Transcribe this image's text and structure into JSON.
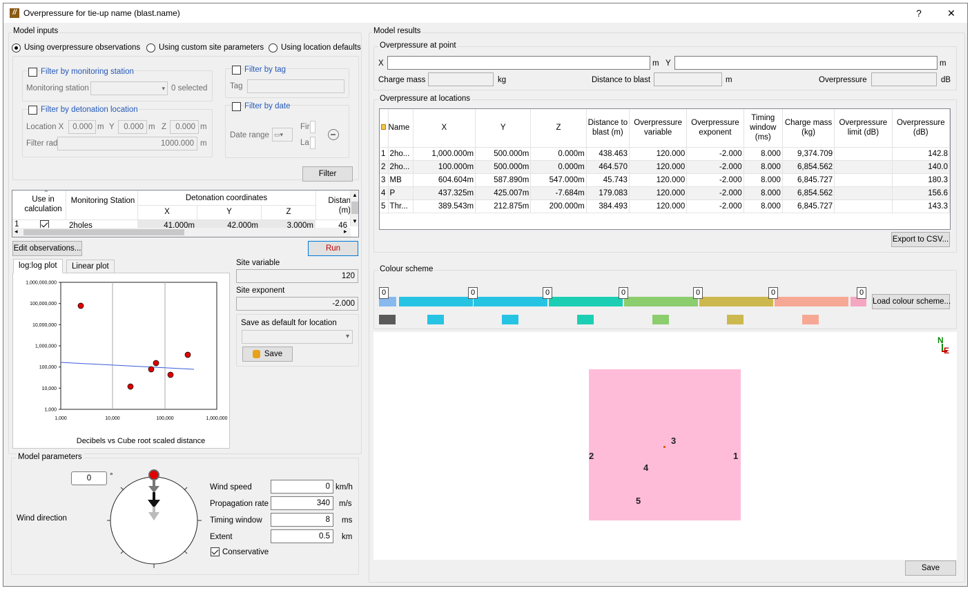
{
  "window": {
    "title": "Overpressure for tie-up name (blast.name)",
    "help": "?",
    "close": "✕",
    "icon": "app-logo"
  },
  "inputs": {
    "title": "Model inputs",
    "radios": [
      "Using overpressure observations",
      "Using custom site parameters",
      "Using location defaults"
    ],
    "filter_station": {
      "label": "Filter by monitoring station",
      "field_label": "Monitoring station",
      "count": "0 selected"
    },
    "filter_tag": {
      "label": "Filter by tag",
      "field_label": "Tag"
    },
    "filter_detonation": {
      "label": "Filter by detonation location",
      "location_label": "Location X",
      "x": "0.000",
      "y_label": "Y",
      "y": "0.000",
      "z_label": "Z",
      "z": "0.000",
      "unit": "m",
      "radius_label": "Filter radi",
      "radius": "1000.000"
    },
    "filter_date": {
      "label": "Filter by date",
      "range_label": "Date range",
      "first": "Fir",
      "last": "La"
    },
    "filter_button": "Filter",
    "obs_table": {
      "h_use": "Use in calculation",
      "h_station": "Monitoring Station",
      "h_det": "Detonation coordinates",
      "h_x": "X",
      "h_y": "Y",
      "h_z": "Z",
      "h_dist": "Distan (m)",
      "row": {
        "n": "1",
        "station": "2holes",
        "x": "41.000m",
        "y": "42.000m",
        "z": "3.000m",
        "dist": "46"
      }
    },
    "edit_button": "Edit observations...",
    "run_button": "Run"
  },
  "plot": {
    "tabs": [
      "log:log plot",
      "Linear plot"
    ],
    "yticks": [
      "1,000,000,000",
      "100,000,000",
      "10,000,000",
      "1,000,000",
      "100,000",
      "10,000",
      "1,000"
    ],
    "xticks": [
      "1,000",
      "10,000",
      "100,000",
      "1,000,000"
    ],
    "caption": "Decibels vs Cube root scaled distance"
  },
  "site": {
    "var_label": "Site variable",
    "var": "120",
    "exp_label": "Site exponent",
    "exp": "-2.000",
    "save_default_label": "Save as default for location",
    "save": "Save"
  },
  "model_params": {
    "title": "Model parameters",
    "wind_dir": "0",
    "deg": "°",
    "wind_dir_label": "Wind direction",
    "wind_speed_label": "Wind speed",
    "wind_speed": "0",
    "wind_speed_unit": "km/h",
    "prop_label": "Propagation rate",
    "prop": "340",
    "prop_unit": "m/s",
    "timing_label": "Timing window",
    "timing": "8",
    "timing_unit": "ms",
    "extent_label": "Extent",
    "extent": "0.5",
    "extent_unit": "km",
    "conservative": "Conservative"
  },
  "results": {
    "title": "Model results",
    "point": {
      "title": "Overpressure at point",
      "x_label": "X",
      "m1": "m",
      "y_label": "Y",
      "m2": "m",
      "charge_label": "Charge mass",
      "kg": "kg",
      "dist_label": "Distance to blast",
      "m3": "m",
      "op_label": "Overpressure",
      "db": "dB"
    },
    "locations": {
      "title": "Overpressure at locations",
      "headers": [
        "Name",
        "X",
        "Y",
        "Z",
        "Distance to blast (m)",
        "Overpressure variable",
        "Overpressure exponent",
        "Timing window (ms)",
        "Charge mass (kg)",
        "Overpressure limit (dB)",
        "Overpressure (dB)"
      ],
      "rows": [
        {
          "n": "1",
          "name": "2ho...",
          "x": "1,000.000m",
          "y": "500.000m",
          "z": "0.000m",
          "dist": "438.463",
          "var": "120.000",
          "exp": "-2.000",
          "tw": "8.000",
          "cm": "9,374.709",
          "lim": "",
          "op": "142.8"
        },
        {
          "n": "2",
          "name": "2ho...",
          "x": "100.000m",
          "y": "500.000m",
          "z": "0.000m",
          "dist": "464.570",
          "var": "120.000",
          "exp": "-2.000",
          "tw": "8.000",
          "cm": "6,854.562",
          "lim": "",
          "op": "140.0"
        },
        {
          "n": "3",
          "name": "MB",
          "x": "604.604m",
          "y": "587.890m",
          "z": "547.000m",
          "dist": "45.743",
          "var": "120.000",
          "exp": "-2.000",
          "tw": "8.000",
          "cm": "6,845.727",
          "lim": "",
          "op": "180.3"
        },
        {
          "n": "4",
          "name": "P",
          "x": "437.325m",
          "y": "425.007m",
          "z": "-7.684m",
          "dist": "179.083",
          "var": "120.000",
          "exp": "-2.000",
          "tw": "8.000",
          "cm": "6,854.562",
          "lim": "",
          "op": "156.6"
        },
        {
          "n": "5",
          "name": "Thr...",
          "x": "389.543m",
          "y": "212.875m",
          "z": "200.000m",
          "dist": "384.493",
          "var": "120.000",
          "exp": "-2.000",
          "tw": "8.000",
          "cm": "6,845.727",
          "lim": "",
          "op": "143.3"
        }
      ],
      "export": "Export to CSV..."
    },
    "colour": {
      "title": "Colour scheme",
      "index": "0",
      "load": "Load colour scheme...",
      "colors": [
        "#87b9ee",
        "#27c3e3",
        "#27c3e3",
        "#1ccfb4",
        "#8ccd6e",
        "#ccb84e",
        "#f6a894",
        "#f5a7c2"
      ],
      "squares": [
        "#5a5a5a",
        "#27c3e3",
        "#27c3e3",
        "#1ccfb4",
        "#8ccd6e",
        "#ccb84e",
        "#f6a894"
      ]
    },
    "map": {
      "north": "N",
      "east": "E",
      "fill": "#ffbcd9",
      "points": [
        "1",
        "2",
        "3",
        "4",
        "5"
      ]
    },
    "save": "Save"
  }
}
